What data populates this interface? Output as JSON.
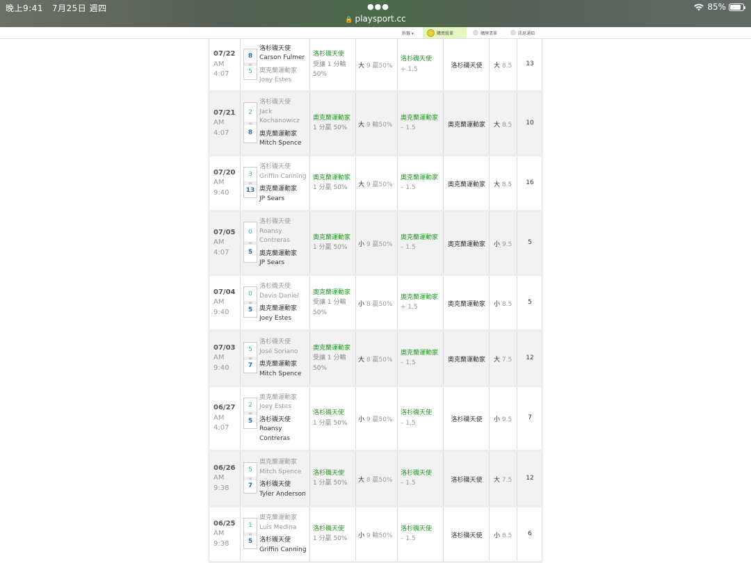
{
  "status": {
    "time": "晚上9:41",
    "date": "7月25日 週四",
    "url": "playsport.cc",
    "battery": "85%",
    "battery_level": 0.85
  },
  "nav": {
    "items": [
      {
        "label": "幹籤 ▾"
      },
      {
        "label": "購買殺單",
        "active": true
      },
      {
        "label": "購牌清單"
      },
      {
        "label": "訊息通知"
      }
    ]
  },
  "games": [
    {
      "date": "07/22",
      "ampm": "AM",
      "time": "4:07",
      "away": {
        "team": "洛杉磯天使",
        "pitcher": "Carson Fulmer",
        "score": "8",
        "win": true
      },
      "home": {
        "team": "奧克蘭運動家",
        "pitcher": "Joey Estes",
        "score": "5",
        "win": false
      },
      "ah_team": "洛杉磯天使",
      "ah_line": "受讓 1 分輸 50%",
      "ou_side": "大",
      "ou_line": "9",
      "ou_res": "贏50%",
      "pick_team": "洛杉磯天使",
      "pick_line": "+ 1.5",
      "winner": "洛杉磯天使",
      "ou2_side": "大",
      "ou2_line": "8.5",
      "total": "13"
    },
    {
      "date": "07/21",
      "ampm": "AM",
      "time": "4:07",
      "away": {
        "team": "洛杉磯天使",
        "pitcher": "Jack Kochanowicz",
        "score": "2",
        "win": false
      },
      "home": {
        "team": "奧克蘭運動家",
        "pitcher": "Mitch Spence",
        "score": "8",
        "win": true
      },
      "ah_team": "奧克蘭運動家",
      "ah_line": "1 分贏 50%",
      "ou_side": "大",
      "ou_line": "9",
      "ou_res": "輸50%",
      "pick_team": "奧克蘭運動家",
      "pick_line": "– 1.5",
      "winner": "奧克蘭運動家",
      "ou2_side": "大",
      "ou2_line": "8.5",
      "total": "10"
    },
    {
      "date": "07/20",
      "ampm": "AM",
      "time": "9:40",
      "away": {
        "team": "洛杉磯天使",
        "pitcher": "Griffin Canning",
        "score": "3",
        "win": false
      },
      "home": {
        "team": "奧克蘭運動家",
        "pitcher": "JP Sears",
        "score": "13",
        "win": true
      },
      "ah_team": "奧克蘭運動家",
      "ah_line": "1 分贏 50%",
      "ou_side": "大",
      "ou_line": "9",
      "ou_res": "贏50%",
      "pick_team": "奧克蘭運動家",
      "pick_line": "– 1.5",
      "winner": "奧克蘭運動家",
      "ou2_side": "大",
      "ou2_line": "8.5",
      "total": "16"
    },
    {
      "date": "07/05",
      "ampm": "AM",
      "time": "4:07",
      "away": {
        "team": "洛杉磯天使",
        "pitcher": "Roansy Contreras",
        "score": "0",
        "win": false
      },
      "home": {
        "team": "奧克蘭運動家",
        "pitcher": "JP Sears",
        "score": "5",
        "win": true
      },
      "ah_team": "奧克蘭運動家",
      "ah_line": "1 分贏 50%",
      "ou_side": "小",
      "ou_line": "9",
      "ou_res": "贏50%",
      "pick_team": "奧克蘭運動家",
      "pick_line": "– 1.5",
      "winner": "奧克蘭運動家",
      "ou2_side": "小",
      "ou2_line": "9.5",
      "total": "5"
    },
    {
      "date": "07/04",
      "ampm": "AM",
      "time": "9:40",
      "away": {
        "team": "洛杉磯天使",
        "pitcher": "Davis Daniel",
        "score": "0",
        "win": false
      },
      "home": {
        "team": "奧克蘭運動家",
        "pitcher": "Joey Estes",
        "score": "5",
        "win": true
      },
      "ah_team": "奧克蘭運動家",
      "ah_line": "受讓 1 分輸 50%",
      "ou_side": "小",
      "ou_line": "8",
      "ou_res": "贏50%",
      "pick_team": "奧克蘭運動家",
      "pick_line": "+ 1.5",
      "winner": "奧克蘭運動家",
      "ou2_side": "小",
      "ou2_line": "8.5",
      "total": "5"
    },
    {
      "date": "07/03",
      "ampm": "AM",
      "time": "9:40",
      "away": {
        "team": "洛杉磯天使",
        "pitcher": "José Soriano",
        "score": "5",
        "win": false
      },
      "home": {
        "team": "奧克蘭運動家",
        "pitcher": "Mitch Spence",
        "score": "7",
        "win": true
      },
      "ah_team": "奧克蘭運動家",
      "ah_line": "受讓 1 分輸 50%",
      "ou_side": "大",
      "ou_line": "8",
      "ou_res": "贏50%",
      "pick_team": "奧克蘭運動家",
      "pick_line": "– 1.5",
      "winner": "奧克蘭運動家",
      "ou2_side": "大",
      "ou2_line": "7.5",
      "total": "12"
    },
    {
      "date": "06/27",
      "ampm": "AM",
      "time": "4:07",
      "away": {
        "team": "奧克蘭運動家",
        "pitcher": "Joey Estes",
        "score": "2",
        "win": false
      },
      "home": {
        "team": "洛杉磯天使",
        "pitcher": "Roansy Contreras",
        "score": "5",
        "win": true
      },
      "ah_team": "洛杉磯天使",
      "ah_line": "1 分贏 50%",
      "ou_side": "小",
      "ou_line": "9",
      "ou_res": "贏50%",
      "pick_team": "洛杉磯天使",
      "pick_line": "– 1.5",
      "winner": "洛杉磯天使",
      "ou2_side": "小",
      "ou2_line": "9.5",
      "total": "7"
    },
    {
      "date": "06/26",
      "ampm": "AM",
      "time": "9:38",
      "away": {
        "team": "奧克蘭運動家",
        "pitcher": "Mitch Spence",
        "score": "5",
        "win": false
      },
      "home": {
        "team": "洛杉磯天使",
        "pitcher": "Tyler Anderson",
        "score": "7",
        "win": true
      },
      "ah_team": "洛杉磯天使",
      "ah_line": "1 分贏 50%",
      "ou_side": "大",
      "ou_line": "8",
      "ou_res": "贏50%",
      "pick_team": "洛杉磯天使",
      "pick_line": "– 1.5",
      "winner": "洛杉磯天使",
      "ou2_side": "大",
      "ou2_line": "7.5",
      "total": "12"
    },
    {
      "date": "06/25",
      "ampm": "AM",
      "time": "9:38",
      "away": {
        "team": "奧克蘭運動家",
        "pitcher": "Luis Medina",
        "score": "1",
        "win": false
      },
      "home": {
        "team": "洛杉磯天使",
        "pitcher": "Griffin Canning",
        "score": "5",
        "win": true
      },
      "ah_team": "洛杉磯天使",
      "ah_line": "1 分贏 50%",
      "ou_side": "小",
      "ou_line": "9",
      "ou_res": "輸50%",
      "pick_team": "洛杉磯天使",
      "pick_line": "– 1.5",
      "winner": "洛杉磯天使",
      "ou2_side": "小",
      "ou2_line": "8.5",
      "total": "6"
    }
  ]
}
